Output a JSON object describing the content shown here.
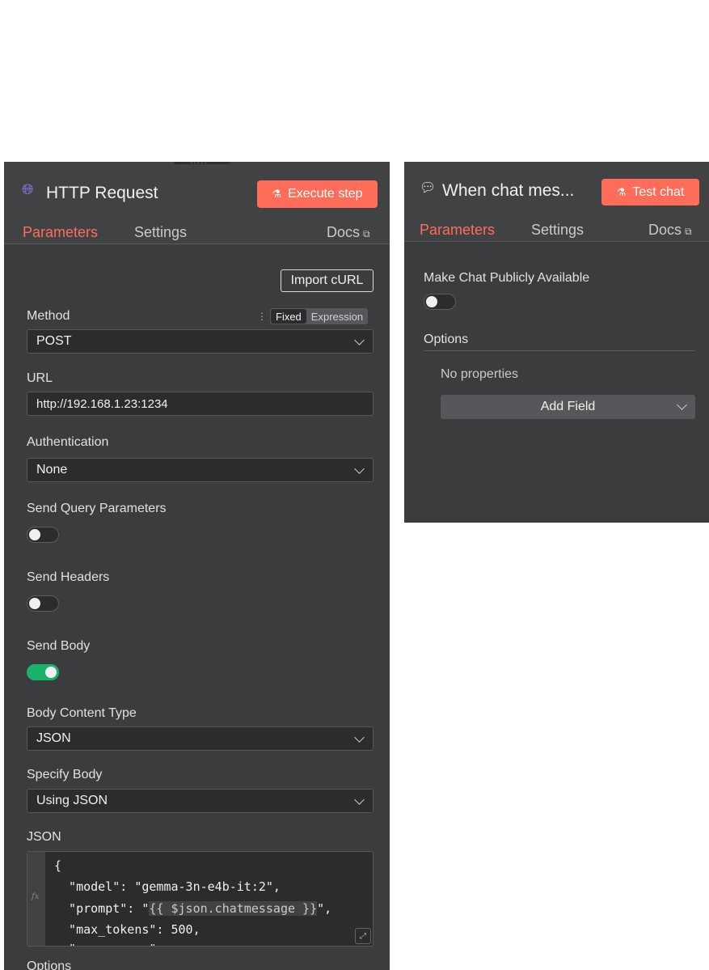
{
  "http_node": {
    "title": "HTTP Request",
    "execute_label": "Execute step",
    "tabs": {
      "parameters": "Parameters",
      "settings": "Settings",
      "docs": "Docs"
    },
    "import_curl_label": "Import cURL",
    "method": {
      "label": "Method",
      "value": "POST",
      "mode_fixed": "Fixed",
      "mode_expression": "Expression"
    },
    "url": {
      "label": "URL",
      "value": "http://192.168.1.23:1234"
    },
    "authentication": {
      "label": "Authentication",
      "value": "None"
    },
    "send_query": {
      "label": "Send Query Parameters",
      "enabled": false
    },
    "send_headers": {
      "label": "Send Headers",
      "enabled": false
    },
    "send_body": {
      "label": "Send Body",
      "enabled": true
    },
    "body_content_type": {
      "label": "Body Content Type",
      "value": "JSON"
    },
    "specify_body": {
      "label": "Specify Body",
      "value": "Using JSON"
    },
    "json": {
      "label": "JSON",
      "line1": "{",
      "line2": "  \"model\": \"gemma-3n-e4b-it:2\",",
      "line3_prefix": "  \"prompt\": \"",
      "line3_expr": "{{ $json.chatmessage }}",
      "line3_suffix": "\",",
      "line4": "  \"max_tokens\": 500,",
      "line5": "  \"          \""
    },
    "options_label": "Options"
  },
  "chat_node": {
    "title": "When chat mes...",
    "test_label": "Test chat",
    "tabs": {
      "parameters": "Parameters",
      "settings": "Settings",
      "docs": "Docs"
    },
    "make_public": {
      "label": "Make Chat Publicly Available",
      "enabled": false
    },
    "options_label": "Options",
    "no_properties": "No properties",
    "add_field_label": "Add Field"
  },
  "colors": {
    "accent": "#ff6d5a",
    "toggle_on": "#19b26b",
    "panel_bg": "#414244"
  }
}
